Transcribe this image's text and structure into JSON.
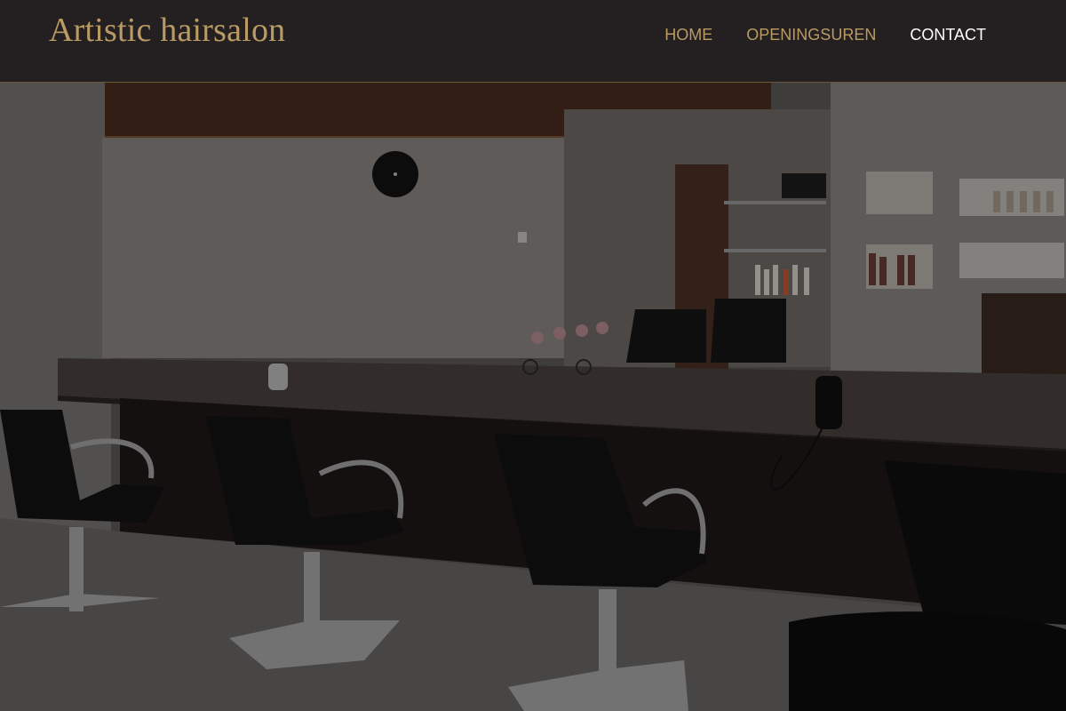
{
  "header": {
    "brand": "Artistic hairsalon",
    "nav": [
      {
        "label": "HOME",
        "active": false
      },
      {
        "label": "OPENINGSUREN",
        "active": false
      },
      {
        "label": "CONTACT",
        "active": true
      }
    ]
  },
  "colors": {
    "header_bg": "#241f20",
    "accent_gold": "#b99b63",
    "active_link": "#ffffff"
  },
  "hero": {
    "subject": "salon-interior-photo"
  }
}
